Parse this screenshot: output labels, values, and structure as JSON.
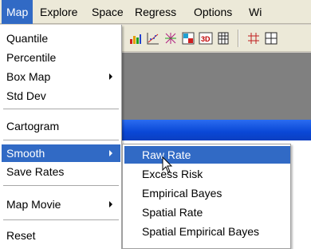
{
  "menubar": {
    "items": [
      {
        "label": "Map",
        "active": true
      },
      {
        "label": "Explore"
      },
      {
        "label": "Space"
      },
      {
        "label": "Regress"
      },
      {
        "label": "Options"
      },
      {
        "label": "Wi"
      }
    ]
  },
  "map_menu": {
    "items": [
      {
        "label": "Quantile"
      },
      {
        "label": "Percentile"
      },
      {
        "label": "Box Map",
        "has_submenu": true
      },
      {
        "label": "Std Dev"
      },
      {
        "label": "Cartogram"
      },
      {
        "label": "Smooth",
        "has_submenu": true,
        "highlighted": true
      },
      {
        "label": "Save Rates"
      },
      {
        "label": "Map Movie",
        "has_submenu": true
      },
      {
        "label": "Reset"
      }
    ]
  },
  "smooth_submenu": {
    "items": [
      {
        "label": "Raw Rate",
        "highlighted": true
      },
      {
        "label": "Excess Risk"
      },
      {
        "label": "Empirical Bayes"
      },
      {
        "label": "Spatial Rate"
      },
      {
        "label": "Spatial Empirical Bayes"
      }
    ]
  },
  "toolbar": {
    "icons": [
      "histogram-icon",
      "scatter-plot-icon",
      "parallel-coordinate-icon",
      "conditional-plot-icon",
      "3d-plot-icon",
      "table-icon",
      "weights-icon",
      "grid-icon"
    ]
  },
  "colors": {
    "highlight": "#316ac5",
    "titlebar": "#0a47d6",
    "menubar_bg": "#ece9d8"
  }
}
